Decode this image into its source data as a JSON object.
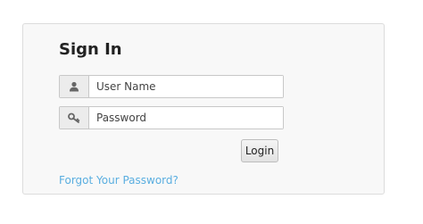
{
  "signin": {
    "title": "Sign In",
    "username": {
      "placeholder": "User Name",
      "value": "",
      "icon": "user-icon"
    },
    "password": {
      "placeholder": "Password",
      "value": "",
      "icon": "key-icon"
    },
    "login_label": "Login",
    "forgot_label": "Forgot Your Password?"
  },
  "colors": {
    "link": "#5aaee0",
    "card_background": "#f8f8f8",
    "border": "#dcdcdc"
  }
}
